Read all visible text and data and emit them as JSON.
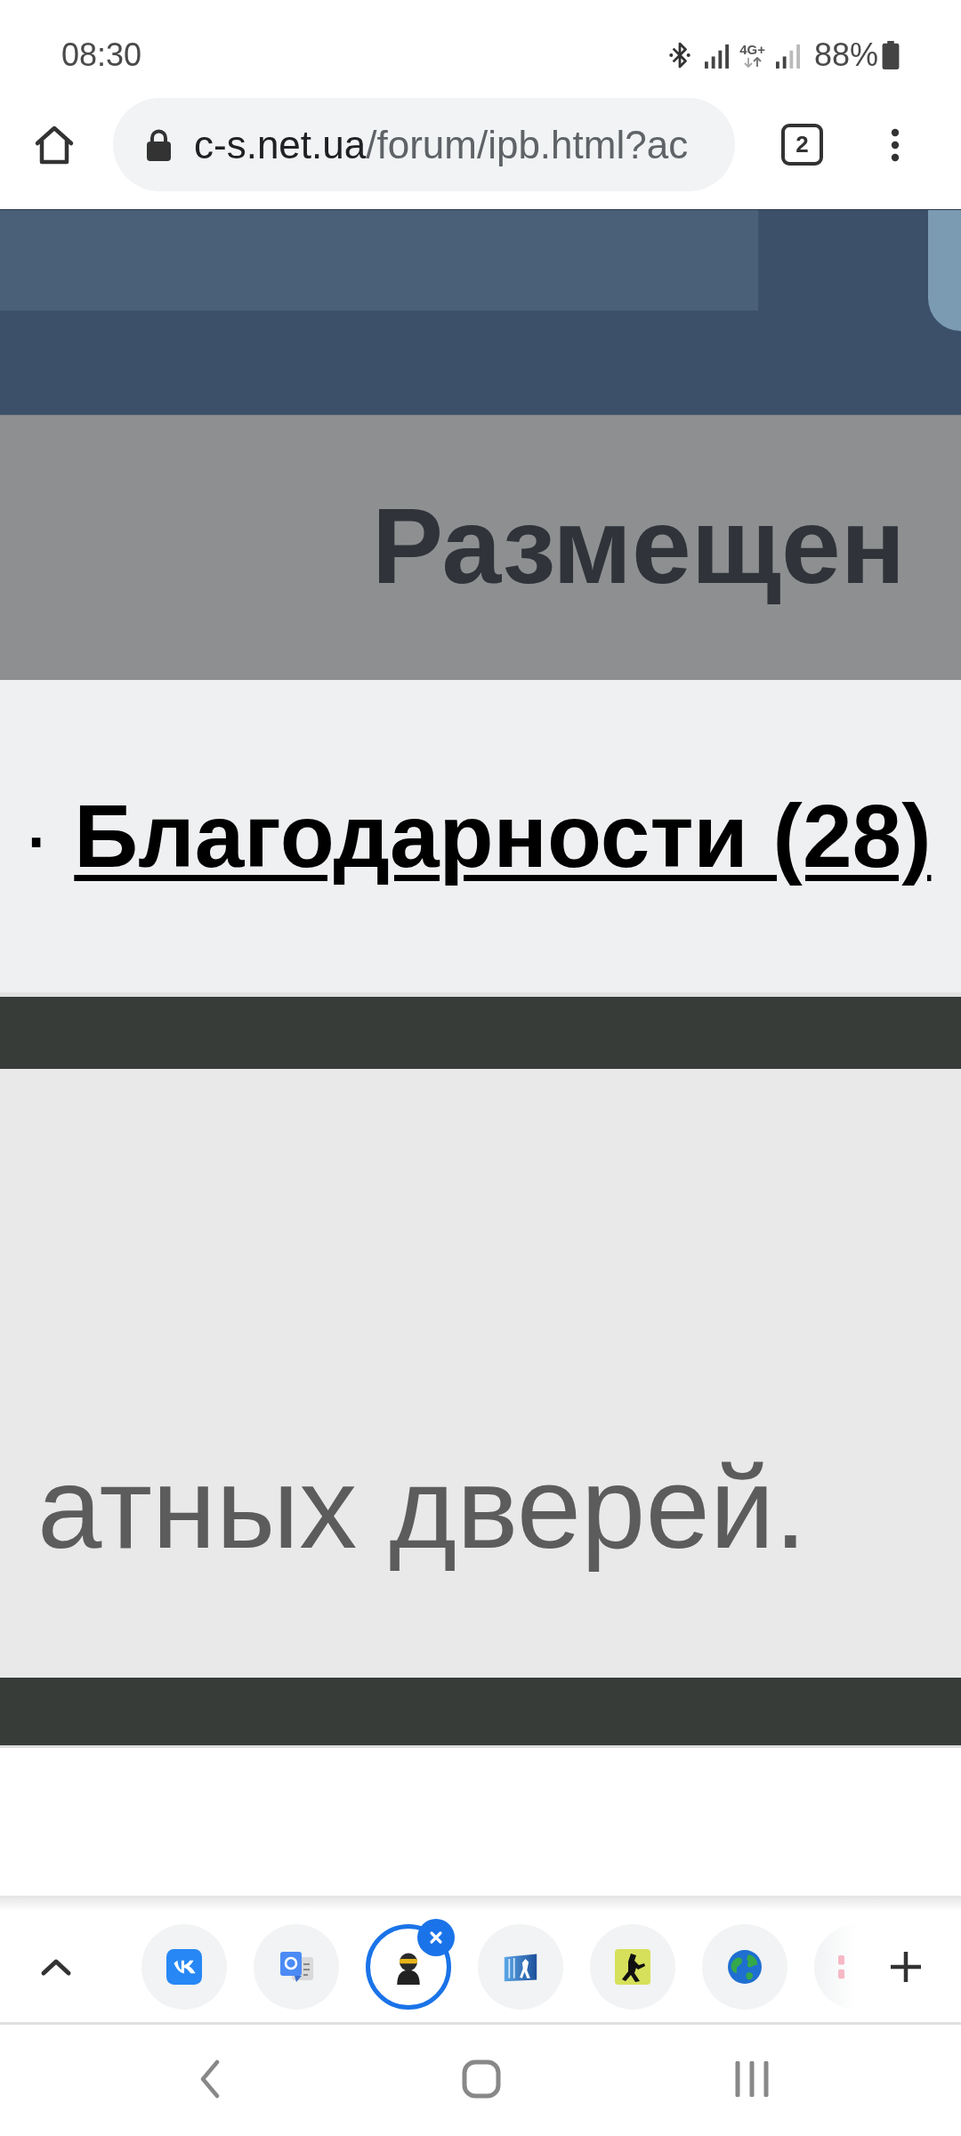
{
  "status_bar": {
    "time": "08:30",
    "network_type": "4G+",
    "battery": "88%"
  },
  "browser_toolbar": {
    "url": {
      "host": "c-s.net.ua",
      "path": "/forum/ipb.html?ac"
    },
    "tab_count": "2"
  },
  "page": {
    "heading": "Размещен",
    "links": [
      {
        "separator": "·",
        "label": "Благодарности (28)"
      }
    ],
    "body_text": "атных дверей."
  },
  "tab_strip": {
    "tabs": [
      {
        "kind": "tile",
        "selected": false
      },
      {
        "kind": "translate",
        "selected": false
      },
      {
        "kind": "figure",
        "selected": true
      },
      {
        "kind": "panel",
        "selected": false
      },
      {
        "kind": "soldier",
        "selected": false
      },
      {
        "kind": "globe",
        "selected": false
      },
      {
        "kind": "partial",
        "selected": false
      }
    ]
  }
}
